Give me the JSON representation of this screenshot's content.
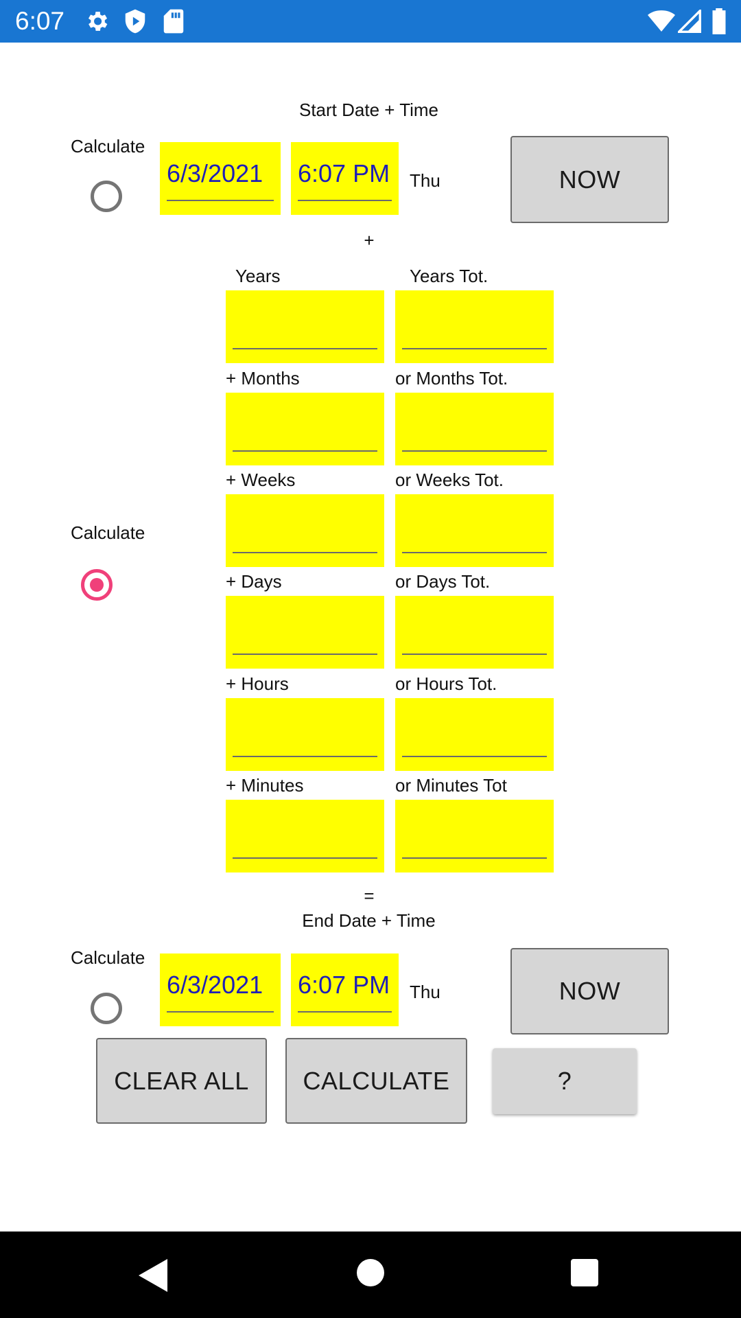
{
  "status_bar": {
    "time": "6:07",
    "color": "#1976d2",
    "left_icons": [
      "gear-icon",
      "play-shield-icon",
      "sd-card-icon"
    ],
    "right_icons": [
      "wifi-icon",
      "signal-icon",
      "battery-icon"
    ]
  },
  "start": {
    "heading": "Start Date + Time",
    "calculate_label": "Calculate",
    "radio_selected": false,
    "date": "6/3/2021",
    "time": "6:07 PM",
    "weekday": "Thu",
    "now_label": "NOW"
  },
  "plus_sign": "+",
  "equals_sign": "=",
  "middle": {
    "calculate_label": "Calculate",
    "radio_selected": true
  },
  "rows": [
    {
      "left_label": "Years",
      "right_label": "Years Tot.",
      "left_value": "",
      "right_value": ""
    },
    {
      "left_label": "+ Months",
      "right_label": "or Months Tot.",
      "left_value": "",
      "right_value": ""
    },
    {
      "left_label": "+ Weeks",
      "right_label": "or Weeks Tot.",
      "left_value": "",
      "right_value": ""
    },
    {
      "left_label": "+ Days",
      "right_label": "or Days Tot.",
      "left_value": "",
      "right_value": ""
    },
    {
      "left_label": "+ Hours",
      "right_label": "or Hours Tot.",
      "left_value": "",
      "right_value": ""
    },
    {
      "left_label": "+ Minutes",
      "right_label": "or Minutes Tot",
      "left_value": "",
      "right_value": ""
    }
  ],
  "end": {
    "heading": "End Date + Time",
    "calculate_label": "Calculate",
    "radio_selected": false,
    "date": "6/3/2021",
    "time": "6:07 PM",
    "weekday": "Thu",
    "now_label": "NOW"
  },
  "actions": {
    "clear_all": "CLEAR ALL",
    "calculate": "CALCULATE",
    "help": "?"
  },
  "colors": {
    "field_bg": "#ffff00",
    "field_text": "#1f1fb8",
    "radio_accent": "#f0407a",
    "button_bg": "#d6d6d6"
  },
  "nav_bar": {
    "icons": [
      "back-icon",
      "home-icon",
      "recents-icon"
    ]
  }
}
